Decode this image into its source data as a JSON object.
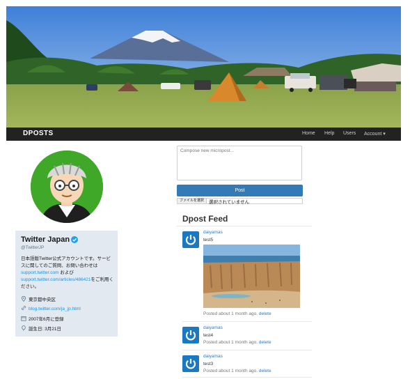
{
  "navbar": {
    "brand": "DPOSTS",
    "links": [
      "Home",
      "Help",
      "Users",
      "Account ▾"
    ]
  },
  "profile": {
    "name": "Twitter Japan",
    "handle": "@TwitterJP",
    "bio_pre": "日本語版Twitter公式アカウントです。サービスに関してのご質問、お問い合わせは",
    "bio_link1": "support.twitter.com",
    "bio_mid": " および ",
    "bio_link2": "support.twitter.com/articles/486421",
    "bio_post": "をご利用ください。",
    "location": "東京都中央区",
    "website": "blog.twitter.com/ja_jp.html",
    "joined": "2007年6月に登録",
    "birthday": "誕生日: 3月21日"
  },
  "compose": {
    "placeholder": "Compose new micropost...",
    "post_label": "Post",
    "file_button": "ファイルを選択",
    "file_status": "選択されていません"
  },
  "feed": {
    "title": "Dpost Feed",
    "posts": [
      {
        "user": "daiyamas",
        "content": "test5",
        "meta": "Posted about 1 month ago.",
        "delete": "delete"
      },
      {
        "user": "daiyamas",
        "content": "test4",
        "meta": "Posted about 1 month ago.",
        "delete": "delete"
      },
      {
        "user": "daiyamas",
        "content": "test3",
        "meta": "Posted about 1 month ago.",
        "delete": "delete"
      }
    ]
  }
}
